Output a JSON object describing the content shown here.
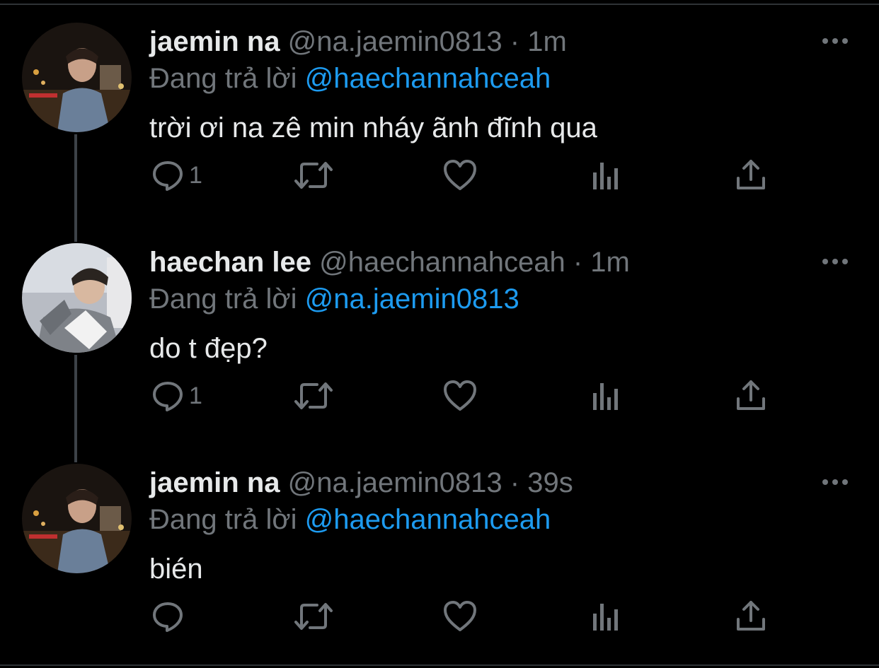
{
  "reply_prefix": "Đang trả lời",
  "tweets": [
    {
      "name": "jaemin na",
      "handle": "@na.jaemin0813",
      "separator": "·",
      "time": "1m",
      "reply_to": "@haechannahceah",
      "text": "trời ơi na zê min nháy ãnh đĩnh qua",
      "reply_count": "1"
    },
    {
      "name": "haechan lee",
      "handle": "@haechannahceah",
      "separator": "·",
      "time": "1m",
      "reply_to": "@na.jaemin0813",
      "text": "do t đẹp?",
      "reply_count": "1"
    },
    {
      "name": "jaemin na",
      "handle": "@na.jaemin0813",
      "separator": "·",
      "time": "39s",
      "reply_to": "@haechannahceah",
      "text": "bién",
      "reply_count": ""
    }
  ],
  "icons": {
    "reply": "reply-icon",
    "retweet": "retweet-icon",
    "like": "heart-icon",
    "views": "analytics-icon",
    "share": "share-icon",
    "more": "more-icon"
  },
  "colors": {
    "background": "#000000",
    "text": "#e7e9ea",
    "muted": "#71767b",
    "mention": "#1d9bf0",
    "thread_line": "#3d4248"
  }
}
